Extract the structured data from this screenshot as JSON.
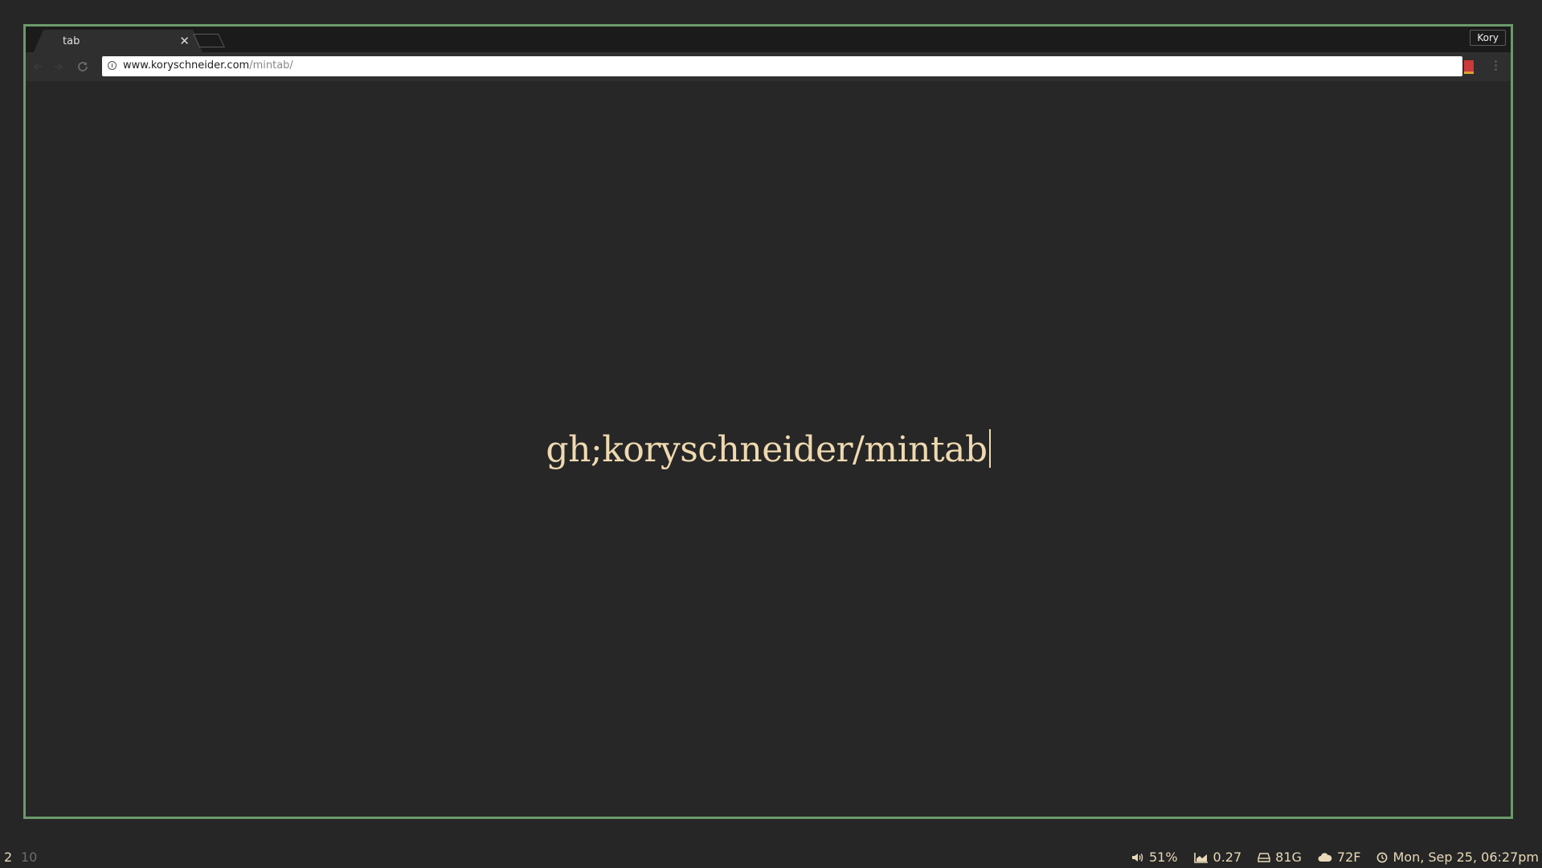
{
  "browser": {
    "tab": {
      "title": "tab",
      "close_glyph": "✕"
    },
    "profile": {
      "name": "Kory"
    },
    "address_bar": {
      "host": "www.koryschneider.com",
      "path": "/mintab/"
    }
  },
  "page": {
    "query_text": "gh;koryschneider/mintab"
  },
  "status_bar": {
    "workspaces": [
      {
        "label": "2",
        "active": true
      },
      {
        "label": "10",
        "active": false
      }
    ],
    "volume": {
      "icon": "speaker-icon",
      "value": "51%"
    },
    "load": {
      "icon": "area-chart-icon",
      "value": "0.27"
    },
    "disk": {
      "icon": "hard-drive-icon",
      "value": "81G"
    },
    "weather": {
      "icon": "cloud-icon",
      "value": "72F"
    },
    "clock": {
      "icon": "clock-icon",
      "value": "Mon, Sep 25, 06:27pm"
    }
  },
  "colors": {
    "window_border": "#6b9a6b",
    "background": "#262626",
    "accent_text": "#efd9b0"
  }
}
